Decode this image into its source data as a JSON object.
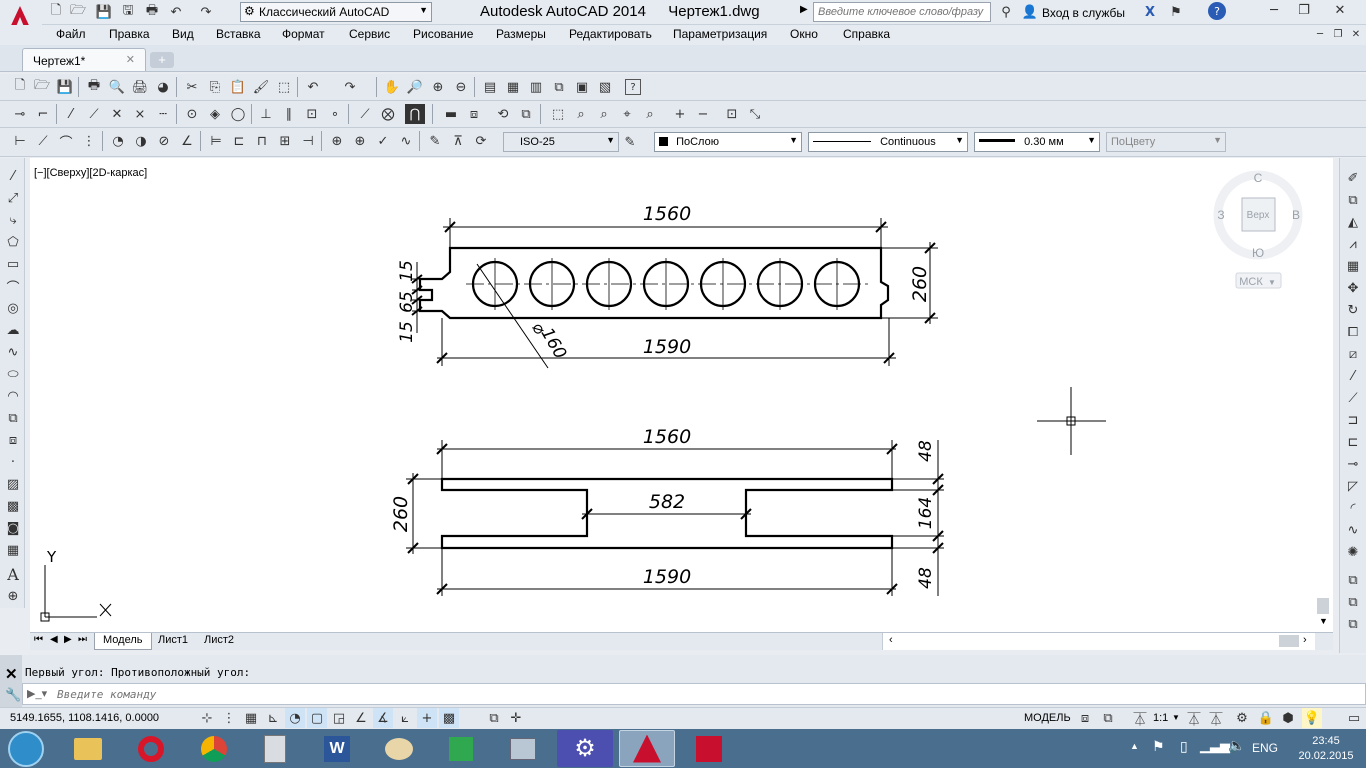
{
  "titlebar": {
    "workspace": "Классический AutoCAD",
    "app_title": "Autodesk AutoCAD 2014",
    "file_name": "Чертеж1.dwg",
    "search_placeholder": "Введите ключевое слово/фразу",
    "signin": "Вход в службы"
  },
  "menu": [
    "Файл",
    "Правка",
    "Вид",
    "Вставка",
    "Формат",
    "Сервис",
    "Рисование",
    "Размеры",
    "Редактировать",
    "Параметризация",
    "Окно",
    "Справка"
  ],
  "file_tab": "Чертеж1*",
  "properties": {
    "dimstyle": "ISO-25",
    "layer_color": "ПоСлою",
    "linetype": "Continuous",
    "lineweight": "0.30 мм",
    "plotstyle": "ПоЦвету"
  },
  "viewport_label": "[−][Сверху][2D-каркас]",
  "viewcube": {
    "north": "С",
    "south": "Ю",
    "west": "З",
    "east": "В",
    "top": "Верх",
    "ucs": "МСК"
  },
  "ucs_icon": {
    "x": "X",
    "y": "Y"
  },
  "drawing": {
    "top_view": {
      "width_top": "1560",
      "width_bottom": "1590",
      "height": "260",
      "left_dims": [
        "15",
        "65",
        "15"
      ],
      "hole_diameter": "160"
    },
    "bottom_view": {
      "width_top": "1560",
      "width_bottom": "1590",
      "height": "260",
      "gap": "582",
      "right_dims": [
        "48",
        "164",
        "48"
      ]
    }
  },
  "layout_tabs": [
    "Модель",
    "Лист1",
    "Лист2"
  ],
  "command": {
    "history": "Первый угол: Противоположный угол:",
    "prompt_placeholder": "Введите команду"
  },
  "status": {
    "coords": "5149.1655, 1108.1416, 0.0000",
    "model": "МОДЕЛЬ",
    "scale": "1:1"
  },
  "taskbar": {
    "lang": "ENG",
    "time": "23:45",
    "date": "20.02.2015"
  }
}
